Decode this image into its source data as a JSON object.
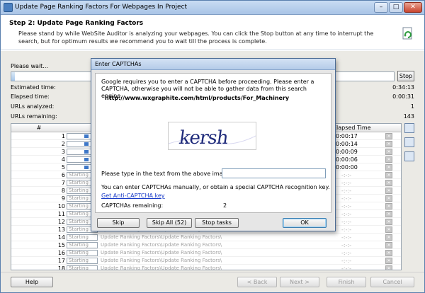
{
  "window": {
    "title": "Update Page Ranking Factors For Webpages In Project"
  },
  "header": {
    "step_title": "Step 2: Update Page Ranking Factors",
    "description": "Please stand by while WebSite Auditor is analyzing your webpages. You can click the Stop button at any time to interrupt the search, but for optimum results we recommend you to wait till the process is complete."
  },
  "progress": {
    "label": "Please wait...",
    "stop_label": "Stop"
  },
  "stats": [
    {
      "label": "Estimated time:",
      "value": "0:34:13"
    },
    {
      "label": "Elapsed time:",
      "value": "0:00:31"
    },
    {
      "label": "URLs analyzed:",
      "value": "1"
    },
    {
      "label": "URLs remaining:",
      "value": "143"
    }
  ],
  "table": {
    "headers": {
      "number": "#",
      "elapsed": "Elapsed Time"
    },
    "rows": [
      {
        "num": "1",
        "status": "",
        "task": "",
        "time": "0:00:17"
      },
      {
        "num": "2",
        "status": "",
        "task": "",
        "time": "0:00:14"
      },
      {
        "num": "3",
        "status": "",
        "task": "",
        "time": "0:00:09"
      },
      {
        "num": "4",
        "status": "",
        "task": "",
        "time": "0:00:06"
      },
      {
        "num": "5",
        "status": "",
        "task": "",
        "time": "0:00:00"
      },
      {
        "num": "6",
        "status": "Starting",
        "task": "",
        "time": "-:-:-"
      },
      {
        "num": "7",
        "status": "Starting",
        "task": "",
        "time": "-:-:-"
      },
      {
        "num": "8",
        "status": "Starting",
        "task": "",
        "time": "-:-:-"
      },
      {
        "num": "9",
        "status": "Starting",
        "task": "",
        "time": "-:-:-"
      },
      {
        "num": "10",
        "status": "Starting",
        "task": "",
        "time": "-:-:-"
      },
      {
        "num": "11",
        "status": "Starting",
        "task": "",
        "time": "-:-:-"
      },
      {
        "num": "12",
        "status": "Starting",
        "task": "",
        "time": "-:-:-"
      },
      {
        "num": "13",
        "status": "Starting",
        "task": "Update Ranking Factors\\Update Ranking Factors\\",
        "time": "-:-:-"
      },
      {
        "num": "14",
        "status": "Starting",
        "task": "Update Ranking Factors\\Update Ranking Factors\\",
        "time": "-:-:-"
      },
      {
        "num": "15",
        "status": "Starting",
        "task": "Update Ranking Factors\\Update Ranking Factors\\",
        "time": "-:-:-"
      },
      {
        "num": "16",
        "status": "Starting",
        "task": "Update Ranking Factors\\Update Ranking Factors\\",
        "time": "-:-:-"
      },
      {
        "num": "17",
        "status": "Starting",
        "task": "Update Ranking Factors\\Update Ranking Factors\\",
        "time": "-:-:-"
      },
      {
        "num": "18",
        "status": "Starting",
        "task": "Update Ranking Factors\\Update Ranking Factors\\",
        "time": "-:-:-"
      }
    ]
  },
  "dialog": {
    "title": "Enter CAPTCHAs",
    "message": "Google requires you to enter a CAPTCHA before proceeding. Please enter a CAPTCHA, otherwise you will not be able to gather data from this search engine.",
    "url": "http://www.wxgraphite.com/html/products/For_Machinery",
    "captcha_text": "kersh",
    "prompt": "Please type in the text from the above image:",
    "input_value": "",
    "note": "You can enter CAPTCHAs manually, or obtain a special CAPTCHA recognition key.",
    "link": "Get Anti-CAPTCHA key",
    "remaining_label": "CAPTCHAs remaining:",
    "remaining_value": "2",
    "buttons": {
      "skip": "Skip",
      "skip_all": "Skip All (52)",
      "stop_tasks": "Stop tasks",
      "ok": "OK"
    }
  },
  "footer": {
    "help": "Help",
    "back": "< Back",
    "next": "Next >",
    "finish": "Finish",
    "cancel": "Cancel"
  },
  "colors": {
    "accent": "#3f78c8",
    "link": "#1a3cc8",
    "title_bar": "#b4cbe8"
  }
}
